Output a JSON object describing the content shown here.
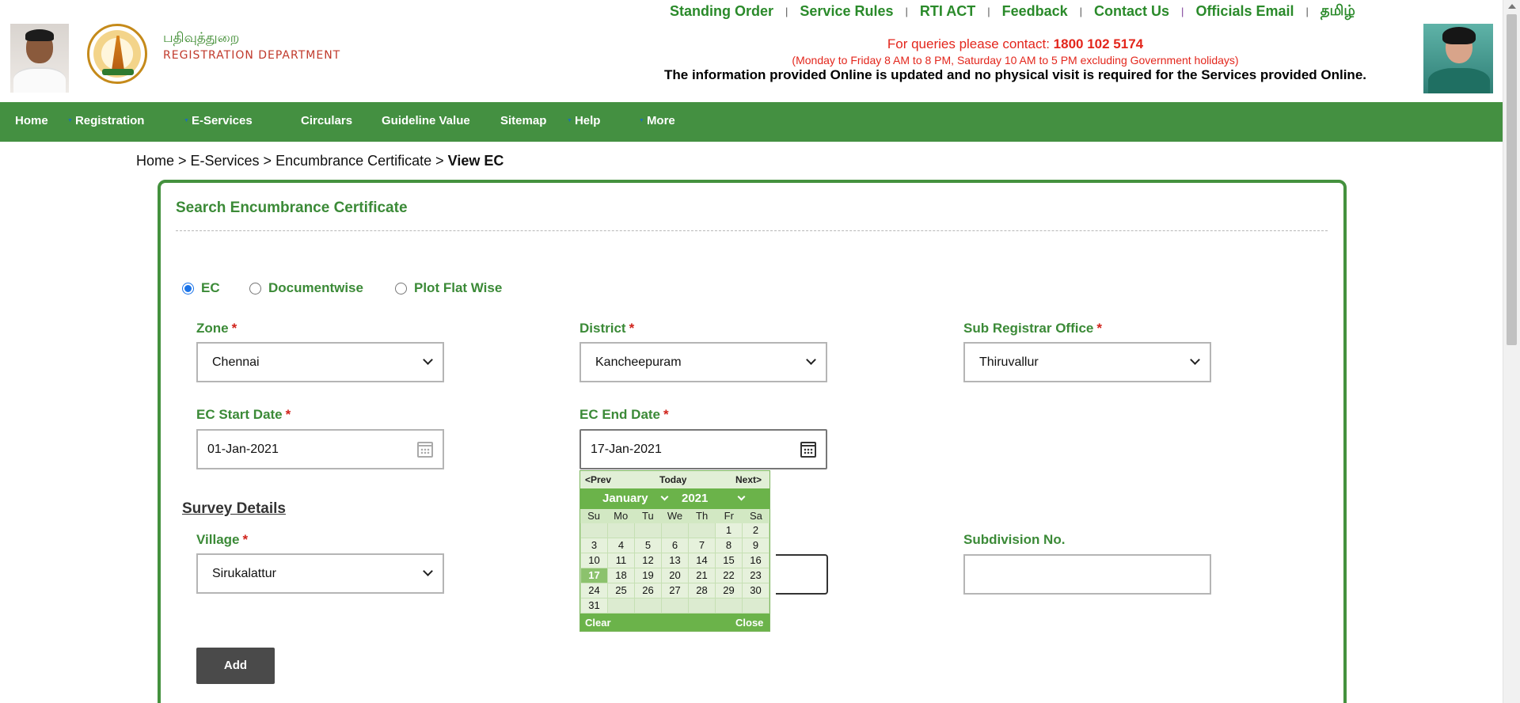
{
  "header": {
    "dept_tamil": "பதிவுத்துறை",
    "dept_english": "REGISTRATION DEPARTMENT",
    "top_links": [
      "Standing Order",
      "Service Rules",
      "RTI ACT",
      "Feedback",
      "Contact Us",
      "Officials Email",
      "தமிழ்"
    ],
    "separator": "|",
    "contact_prefix": "For queries please contact: ",
    "contact_phone": "1800 102 5174",
    "contact_hours": "(Monday to Friday 8 AM to 8 PM, Saturday 10 AM to 5 PM excluding Government holidays)",
    "info_note": "The information provided Online is updated and no physical visit is required for the Services provided Online."
  },
  "nav": {
    "items": [
      "Home",
      "Registration",
      "E-Services",
      "Circulars",
      "Guideline Value",
      "Sitemap",
      "Help",
      "More"
    ]
  },
  "breadcrumb": {
    "path": "Home > E-Services > Encumbrance Certificate > ",
    "current": "View EC"
  },
  "form": {
    "title": "Search Encumbrance Certificate",
    "radios": [
      {
        "label": "EC",
        "checked": true
      },
      {
        "label": "Documentwise",
        "checked": false
      },
      {
        "label": "Plot Flat Wise",
        "checked": false
      }
    ],
    "required_mark": "*",
    "zone": {
      "label": "Zone",
      "value": "Chennai"
    },
    "district": {
      "label": "District",
      "value": "Kancheepuram"
    },
    "sro": {
      "label": "Sub Registrar Office",
      "value": "Thiruvallur"
    },
    "start_date": {
      "label": "EC Start Date",
      "value": "01-Jan-2021"
    },
    "end_date": {
      "label": "EC End Date",
      "value": "17-Jan-2021"
    },
    "survey_heading": "Survey Details",
    "village": {
      "label": "Village",
      "value": "Sirukalattur"
    },
    "subdivision": {
      "label": "Subdivision No.",
      "value": ""
    },
    "add_button": "Add"
  },
  "datepicker": {
    "prev": "<Prev",
    "today": "Today",
    "next": "Next>",
    "month": "January",
    "year": "2021",
    "weekdays": [
      "Su",
      "Mo",
      "Tu",
      "We",
      "Th",
      "Fr",
      "Sa"
    ],
    "first_weekday_index": 5,
    "days_in_month": 31,
    "selected_day": 17,
    "clear": "Clear",
    "close": "Close"
  },
  "colors": {
    "brand_green": "#449041",
    "label_green": "#3b8a37",
    "required_red": "#d0221a",
    "contact_red": "#e3261c"
  }
}
